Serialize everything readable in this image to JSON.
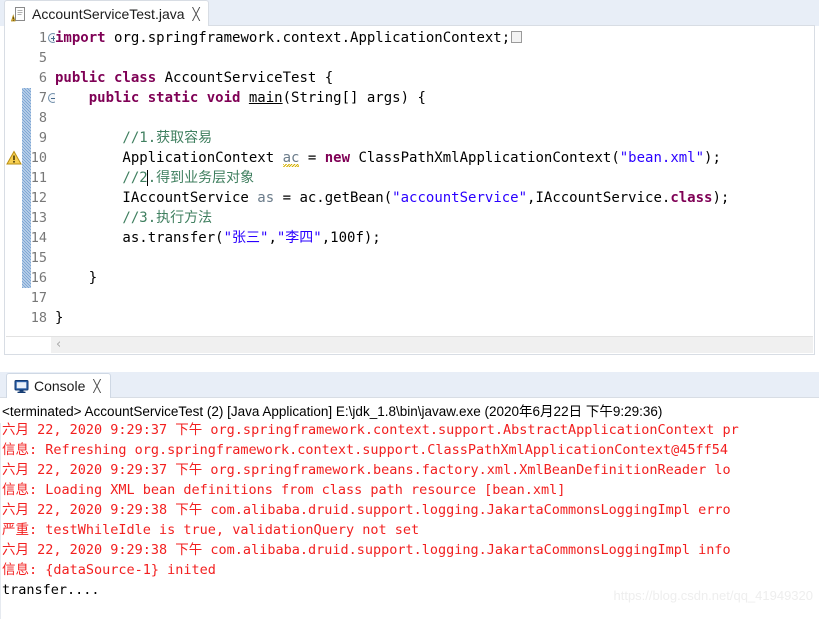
{
  "editor": {
    "tab": {
      "title": "AccountServiceTest.java",
      "close_label": "╳",
      "icon": "java-file-warning-icon"
    },
    "fold_collapsed_marker": "",
    "lines": [
      {
        "num": "1",
        "fold": "plus",
        "segments": [
          {
            "text": "import ",
            "cls": "kw"
          },
          {
            "text": "org.springframework.context.ApplicationContext;",
            "cls": ""
          },
          {
            "text": "",
            "cls": "foldbox"
          }
        ]
      },
      {
        "num": "5",
        "fold": "",
        "segments": []
      },
      {
        "num": "6",
        "fold": "",
        "segments": [
          {
            "text": "public class ",
            "cls": "kw"
          },
          {
            "text": "AccountServiceTest {",
            "cls": ""
          }
        ]
      },
      {
        "num": "7",
        "fold": "minus",
        "segments": [
          {
            "text": "    ",
            "cls": ""
          },
          {
            "text": "public static void ",
            "cls": "kw"
          },
          {
            "text": "main",
            "cls": "mth"
          },
          {
            "text": "(String[] args) {",
            "cls": ""
          }
        ]
      },
      {
        "num": "8",
        "fold": "",
        "segments": []
      },
      {
        "num": "9",
        "fold": "",
        "segments": [
          {
            "text": "        //1.获取容易",
            "cls": "cmt"
          }
        ]
      },
      {
        "num": "10",
        "fold": "",
        "segments": [
          {
            "text": "        ApplicationContext ",
            "cls": ""
          },
          {
            "text": "ac",
            "cls": "lvar-squiggle"
          },
          {
            "text": " = ",
            "cls": ""
          },
          {
            "text": "new ",
            "cls": "kw"
          },
          {
            "text": "ClassPathXmlApplicationContext(",
            "cls": ""
          },
          {
            "text": "\"bean.xml\"",
            "cls": "str"
          },
          {
            "text": ");",
            "cls": ""
          }
        ]
      },
      {
        "num": "11",
        "fold": "",
        "segments": [
          {
            "text": "        //2.得到业务层对象",
            "cls": "cmt"
          }
        ]
      },
      {
        "num": "12",
        "fold": "",
        "segments": [
          {
            "text": "        IAccountService ",
            "cls": ""
          },
          {
            "text": "as",
            "cls": "lvar"
          },
          {
            "text": " = ac.getBean(",
            "cls": ""
          },
          {
            "text": "\"accountService\"",
            "cls": "str"
          },
          {
            "text": ",IAccountService.",
            "cls": ""
          },
          {
            "text": "class",
            "cls": "kw"
          },
          {
            "text": ");",
            "cls": ""
          }
        ]
      },
      {
        "num": "13",
        "fold": "",
        "segments": [
          {
            "text": "        //3.执行方法",
            "cls": "cmt"
          }
        ]
      },
      {
        "num": "14",
        "fold": "",
        "segments": [
          {
            "text": "        as.transfer(",
            "cls": ""
          },
          {
            "text": "\"张三\"",
            "cls": "str"
          },
          {
            "text": ",",
            "cls": ""
          },
          {
            "text": "\"李四\"",
            "cls": "str"
          },
          {
            "text": ",100f);",
            "cls": ""
          }
        ]
      },
      {
        "num": "15",
        "fold": "",
        "segments": []
      },
      {
        "num": "16",
        "fold": "",
        "segments": [
          {
            "text": "    }",
            "cls": ""
          }
        ]
      },
      {
        "num": "17",
        "fold": "",
        "segments": []
      },
      {
        "num": "18",
        "fold": "",
        "segments": [
          {
            "text": "}",
            "cls": ""
          }
        ]
      }
    ],
    "current_line": "11",
    "warning_line": "10",
    "fold_range_start_line": "7",
    "fold_range_end_line": "16",
    "scrollbar": {
      "left_arrow": "‹"
    }
  },
  "console": {
    "tab": {
      "title": "Console",
      "close_label": "╳",
      "icon": "console-monitor-icon"
    },
    "terminated_line": "<terminated> AccountServiceTest (2) [Java Application] E:\\jdk_1.8\\bin\\javaw.exe (2020年6月22日 下午9:29:36)",
    "log": [
      {
        "text": "六月 22, 2020 9:29:37 下午 org.springframework.context.support.AbstractApplicationContext pr",
        "stream": "err"
      },
      {
        "text": "信息: Refreshing org.springframework.context.support.ClassPathXmlApplicationContext@45ff54",
        "stream": "err"
      },
      {
        "text": "六月 22, 2020 9:29:37 下午 org.springframework.beans.factory.xml.XmlBeanDefinitionReader lo",
        "stream": "err"
      },
      {
        "text": "信息: Loading XML bean definitions from class path resource [bean.xml]",
        "stream": "err"
      },
      {
        "text": "六月 22, 2020 9:29:38 下午 com.alibaba.druid.support.logging.JakartaCommonsLoggingImpl erro",
        "stream": "err"
      },
      {
        "text": "严重: testWhileIdle is true, validationQuery not set",
        "stream": "err"
      },
      {
        "text": "六月 22, 2020 9:29:38 下午 com.alibaba.druid.support.logging.JakartaCommonsLoggingImpl info",
        "stream": "err"
      },
      {
        "text": "信息: {dataSource-1} inited",
        "stream": "err"
      },
      {
        "text": "transfer....",
        "stream": "out"
      }
    ],
    "watermark": "https://blog.csdn.net/qq_41949320"
  },
  "colors": {
    "keyword": "#7f0055",
    "comment": "#3f7f5f",
    "string": "#2a00ff",
    "error_text": "#f21f1f",
    "current_line_highlight": "#e8eff9",
    "fold_bar": "#7ea6d4",
    "tab_strip": "#e8eef7"
  }
}
